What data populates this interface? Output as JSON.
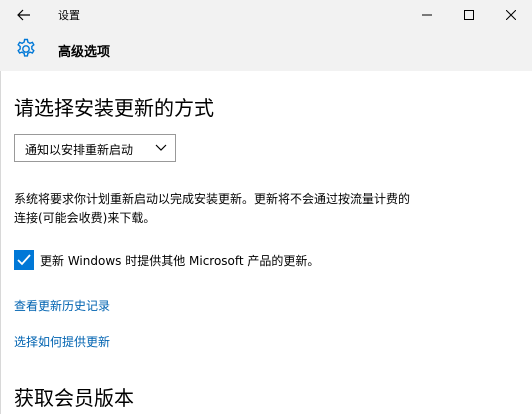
{
  "window": {
    "title": "设置",
    "back_icon": "back-arrow-icon",
    "minimize_icon": "minimize-icon",
    "maximize_icon": "maximize-icon",
    "close_icon": "close-icon"
  },
  "header": {
    "icon": "gear-icon",
    "title": "高级选项"
  },
  "install_section": {
    "title": "请选择安装更新的方式",
    "dropdown_value": "通知以安排重新启动",
    "description": "系统将要求你计划重新启动以完成安装更新。更新将不会通过按流量计费的连接(可能会收费)来下载。",
    "checkbox_checked": true,
    "checkbox_label": "更新 Windows 时提供其他 Microsoft 产品的更新。",
    "link_history": "查看更新历史记录",
    "link_delivery": "选择如何提供更新"
  },
  "insider_section": {
    "title": "获取会员版本"
  },
  "colors": {
    "accent": "#0078d7",
    "link": "#0063b1",
    "chrome": "#f2f2f2"
  }
}
